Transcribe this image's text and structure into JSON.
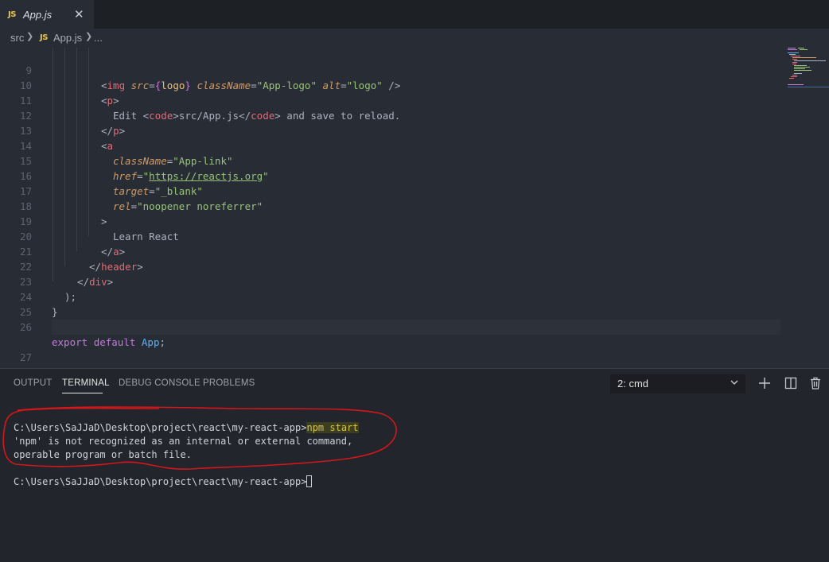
{
  "tab": {
    "icon": "JS",
    "title": "App.js",
    "close": "✕"
  },
  "breadcrumb": {
    "root": "src",
    "icon": "JS",
    "file": "App.js",
    "more": "..."
  },
  "editor": {
    "lines": [
      {
        "n": "9"
      },
      {
        "n": "10"
      },
      {
        "n": "11"
      },
      {
        "n": "12"
      },
      {
        "n": "13"
      },
      {
        "n": "14"
      },
      {
        "n": "15"
      },
      {
        "n": "16"
      },
      {
        "n": "17"
      },
      {
        "n": "18"
      },
      {
        "n": "19"
      },
      {
        "n": "20"
      },
      {
        "n": "21"
      },
      {
        "n": "22"
      },
      {
        "n": "23"
      },
      {
        "n": "24"
      },
      {
        "n": "25"
      },
      {
        "n": "26"
      },
      {
        "n": "27"
      }
    ],
    "tokens": {
      "l9": [
        "<",
        "img",
        " ",
        "src",
        "=",
        "{",
        "logo",
        "}",
        " ",
        "className",
        "=",
        "\"App-logo\"",
        " ",
        "alt",
        "=",
        "\"logo\"",
        " />"
      ],
      "l10": [
        "<",
        "p",
        ">"
      ],
      "l11": [
        "Edit ",
        "<",
        "code",
        ">",
        "src/App.js",
        "</",
        "code",
        ">",
        " and save to reload."
      ],
      "l12": [
        "</",
        "p",
        ">"
      ],
      "l13": [
        "<",
        "a"
      ],
      "l14": [
        "className",
        "=",
        "\"App-link\""
      ],
      "l15": [
        "href",
        "=",
        "\"",
        "https://reactjs.org",
        "\""
      ],
      "l16": [
        "target",
        "=",
        "\"_blank\""
      ],
      "l17": [
        "rel",
        "=",
        "\"noopener noreferrer\""
      ],
      "l18": [
        ">"
      ],
      "l19": [
        "Learn React"
      ],
      "l20": [
        "</",
        "a",
        ">"
      ],
      "l21": [
        "</",
        "header",
        ">"
      ],
      "l22": [
        "</",
        "div",
        ">"
      ],
      "l23": [
        ");"
      ],
      "l24": [
        "}"
      ],
      "l26": [
        "export",
        " ",
        "default",
        " ",
        "App",
        ";"
      ]
    }
  },
  "panel": {
    "tabs": {
      "output": "OUTPUT",
      "terminal": "TERMINAL",
      "debug": "DEBUG CONSOLE",
      "problems": "PROBLEMS"
    },
    "terminal_select": "2: cmd"
  },
  "terminal": {
    "prompt1": "C:\\Users\\SaJJaD\\Desktop\\project\\react\\my-react-app>",
    "command": "npm start",
    "error1": "'npm' is not recognized as an internal or external command,",
    "error2": "operable program or batch file.",
    "prompt2": "C:\\Users\\SaJJaD\\Desktop\\project\\react\\my-react-app>"
  },
  "colors": {
    "editor_bg": "#282c34",
    "panel_bg": "#22252b",
    "tag": "#e06c75",
    "attr": "#d19a66",
    "string": "#98c379",
    "keyword": "#c678dd",
    "annotation": "#d3171b"
  }
}
